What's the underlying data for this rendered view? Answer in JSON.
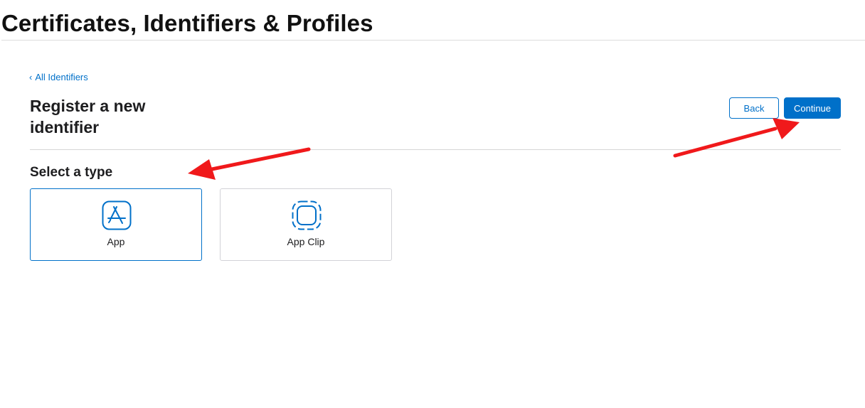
{
  "header": {
    "title": "Certificates, Identifiers & Profiles"
  },
  "breadcrumb": {
    "chevron": "‹",
    "label": "All Identifiers"
  },
  "main": {
    "heading": "Register a new identifier",
    "back_label": "Back",
    "continue_label": "Continue",
    "type_heading": "Select a type",
    "types": [
      {
        "label": "App",
        "icon": "app-store-icon",
        "selected": true
      },
      {
        "label": "App Clip",
        "icon": "app-clip-icon",
        "selected": false
      }
    ]
  },
  "colors": {
    "accent": "#0070c9",
    "annotation_arrow": "#f0191b",
    "divider": "#d6d6d6",
    "card_border": "#d2d2d7"
  },
  "annotations": [
    {
      "icon": "red-arrow-icon",
      "points_to": "Select a type"
    },
    {
      "icon": "red-arrow-icon",
      "points_to": "Continue"
    }
  ]
}
